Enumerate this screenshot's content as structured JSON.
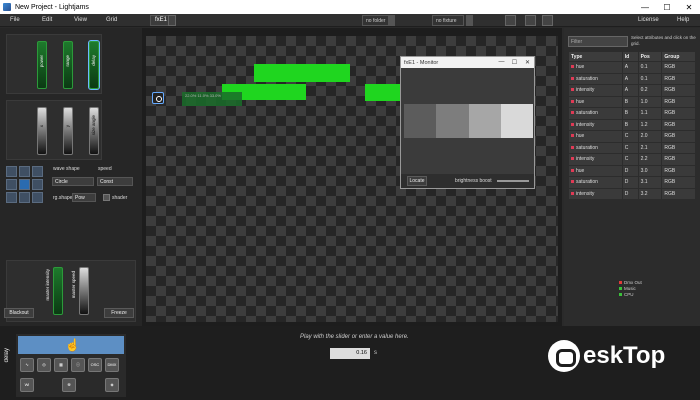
{
  "window": {
    "title": "New Project - Lightjams",
    "controls": [
      "—",
      "☐",
      "✕"
    ]
  },
  "menu": {
    "items": [
      "File",
      "Edit",
      "View",
      "Grid"
    ],
    "right": [
      "License",
      "Help"
    ]
  },
  "tabs": {
    "active": "fxE1"
  },
  "toolbar": {
    "fx_folder": "no folder",
    "fx_fixture": "no fixture"
  },
  "left": {
    "faders_top": [
      "power",
      "range",
      "delay"
    ],
    "faders_mid": [
      "x",
      "y",
      "size angle"
    ],
    "wave_shape_label": "wave shape",
    "speed_label": "speed",
    "wave_shape_value": "Circle",
    "speed_value": "Const",
    "rg_shape_label": "rg.shape",
    "rg_shape_value": "Pow",
    "shader_label": "shader",
    "fader_bottom": [
      "master intensity",
      "master speed"
    ],
    "blackout_label": "Blackout",
    "freeze_label": "Freeze"
  },
  "stage": {
    "selection_text": "22.0% 11.0% 33.0%"
  },
  "monitor": {
    "title": "fxE1 - Monitor",
    "locate_label": "Locate",
    "brightness_label": "brightness boost",
    "swatch_colors": [
      "#5c5c5c",
      "#7d7d7d",
      "#a6a6a6",
      "#d9d9d9"
    ]
  },
  "right": {
    "filter_placeholder": "Filter",
    "hint": "Select attributes and click on the grid.",
    "columns": [
      "Type",
      "Id",
      "Pos",
      "Group"
    ],
    "rows": [
      [
        "hue",
        "A",
        "0.1",
        "RGB"
      ],
      [
        "saturation",
        "A",
        "0.1",
        "RGB"
      ],
      [
        "intensity",
        "A",
        "0.2",
        "RGB"
      ],
      [
        "hue",
        "B",
        "1.0",
        "RGB"
      ],
      [
        "saturation",
        "B",
        "1.1",
        "RGB"
      ],
      [
        "intensity",
        "B",
        "1.2",
        "RGB"
      ],
      [
        "hue",
        "C",
        "2.0",
        "RGB"
      ],
      [
        "saturation",
        "C",
        "2.1",
        "RGB"
      ],
      [
        "intensity",
        "C",
        "2.2",
        "RGB"
      ],
      [
        "hue",
        "D",
        "3.0",
        "RGB"
      ],
      [
        "saturation",
        "D",
        "3.1",
        "RGB"
      ],
      [
        "intensity",
        "D",
        "3.2",
        "RGB"
      ]
    ],
    "status": [
      {
        "label": "Dmx Out",
        "color": "#e03a3a"
      },
      {
        "label": "Music",
        "color": "#3ac13a"
      },
      {
        "label": "CPU",
        "color": "#3ac13a"
      }
    ]
  },
  "bottom": {
    "side_label": "delay",
    "help_text": "Play with the slider or enter a value here.",
    "value": "0.16",
    "unit": "s",
    "modes": [
      "∿",
      "◎",
      "▦",
      "ⓘ",
      "OSC",
      "DMX",
      "Wi",
      "☢",
      "◈"
    ]
  },
  "watermark": {
    "text": "eskTop"
  }
}
